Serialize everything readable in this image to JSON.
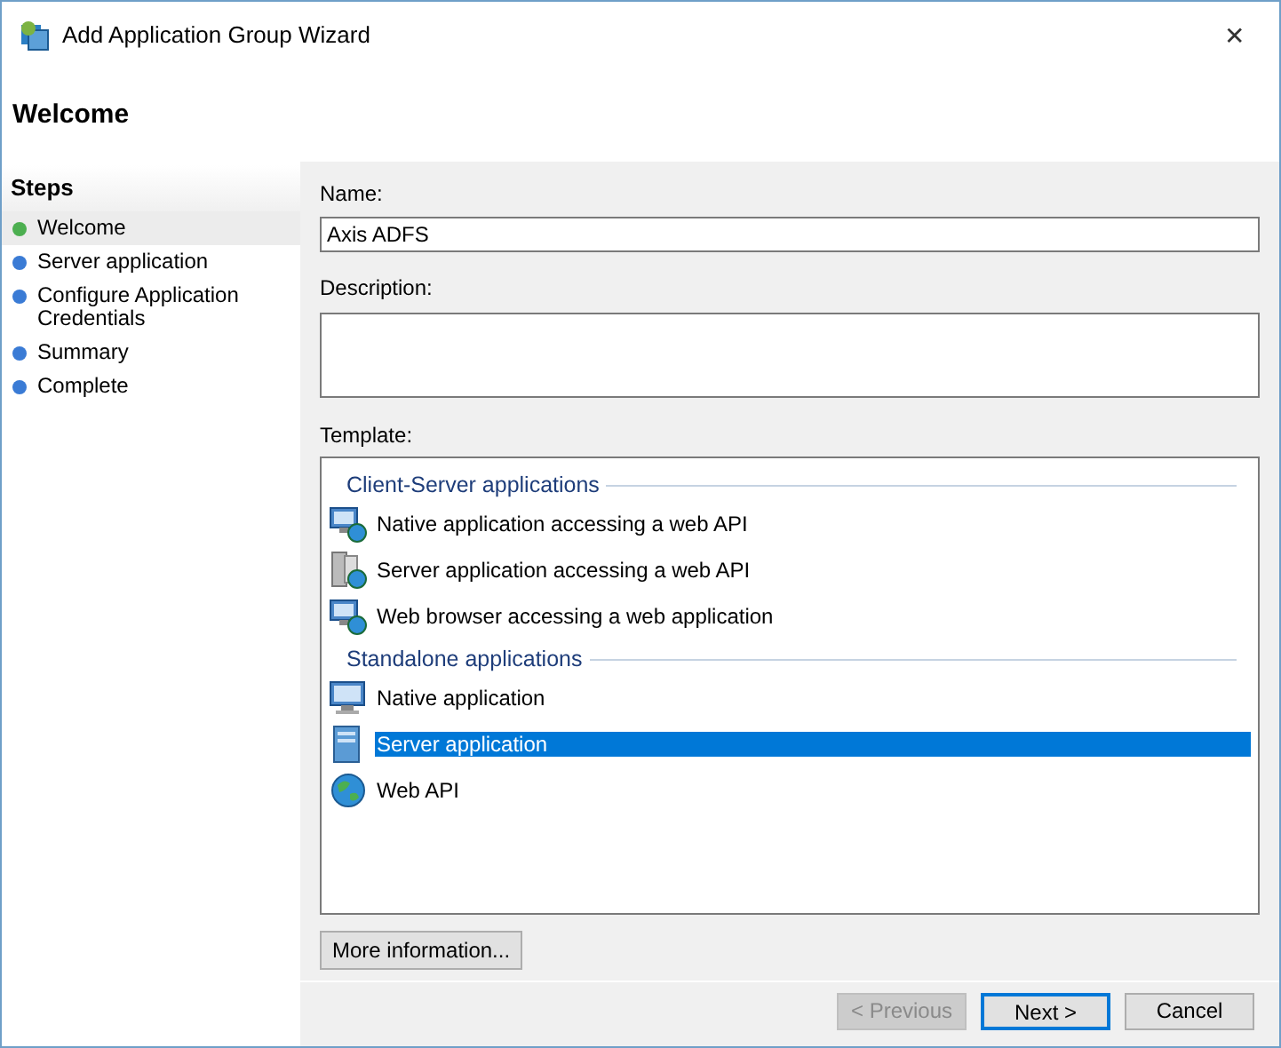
{
  "window": {
    "title": "Add Application Group Wizard",
    "close": "✕"
  },
  "page_title": "Welcome",
  "steps": {
    "heading": "Steps",
    "items": [
      {
        "label": "Welcome",
        "selected": true
      },
      {
        "label": "Server application",
        "selected": false
      },
      {
        "label": "Configure Application Credentials",
        "selected": false
      },
      {
        "label": "Summary",
        "selected": false
      },
      {
        "label": "Complete",
        "selected": false
      }
    ]
  },
  "name": {
    "label": "Name:",
    "value": "Axis ADFS"
  },
  "description": {
    "label": "Description:"
  },
  "template": {
    "label": "Template:",
    "groups": [
      {
        "title": "Client-Server applications",
        "items": [
          {
            "label": "Native application accessing a web API",
            "kind": "native-api",
            "selected": false
          },
          {
            "label": "Server application accessing a web API",
            "kind": "server-api",
            "selected": false
          },
          {
            "label": "Web browser accessing a web application",
            "kind": "browser",
            "selected": false
          }
        ]
      },
      {
        "title": "Standalone applications",
        "items": [
          {
            "label": "Native application",
            "kind": "native",
            "selected": false
          },
          {
            "label": "Server application",
            "kind": "server",
            "selected": true
          },
          {
            "label": "Web API",
            "kind": "webapi",
            "selected": false
          }
        ]
      }
    ]
  },
  "more_button": "More information...",
  "buttons": [
    {
      "label": "< Previous",
      "disabled": true,
      "default": false
    },
    {
      "label": "Next >",
      "disabled": false,
      "default": true
    },
    {
      "label": "Cancel",
      "disabled": false,
      "default": false
    }
  ]
}
